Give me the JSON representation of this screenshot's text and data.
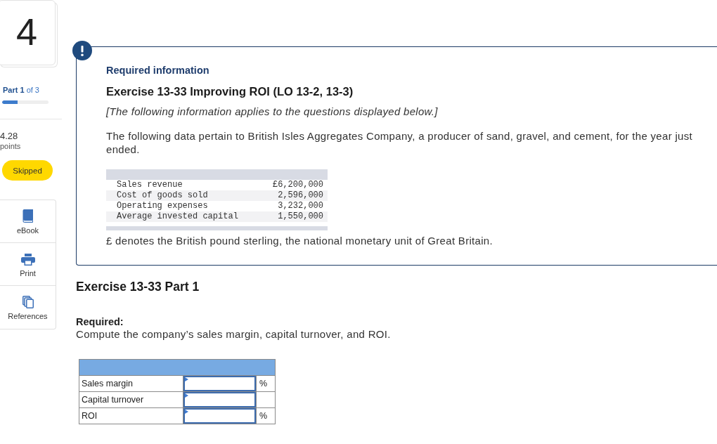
{
  "sidebar": {
    "question_number": "4",
    "part_label": "**Part 1** of 3",
    "progress": {
      "level": 0.33
    },
    "score": "4.28",
    "score_label": "points",
    "status": "Skipped",
    "tools": [
      {
        "kind": "ebook",
        "label": "eBook"
      },
      {
        "kind": "print",
        "label": "Print"
      },
      {
        "kind": "references",
        "label": "References"
      }
    ]
  },
  "required_information": {
    "heading": "Required information",
    "title": "Exercise 13-33 Improving ROI (LO 13-2, 13-3)",
    "note": "[The following information applies to the questions displayed below.]",
    "intro": "The following data pertain to British Isles Aggregates Company, a producer of sand, gravel, and cement, for the year just ended.",
    "data_rows": [
      {
        "label": "Sales revenue",
        "value": "£6,200,000"
      },
      {
        "label": "Cost of goods sold",
        "value": "2,596,000"
      },
      {
        "label": "Operating expenses",
        "value": "3,232,000"
      },
      {
        "label": "Average invested capital",
        "value": "1,550,000"
      }
    ],
    "footnote": "£ denotes the British pound sterling, the national monetary unit of Great Britain."
  },
  "question": {
    "title": "Exercise 13-33 Part 1",
    "required_label": "Required:",
    "instruction": "Compute the company’s sales margin, capital turnover, and ROI.",
    "answer_rows": [
      {
        "label": "Sales margin",
        "unit": "%"
      },
      {
        "label": "Capital turnover"
      },
      {
        "label": "ROI",
        "unit": "%"
      }
    ]
  }
}
